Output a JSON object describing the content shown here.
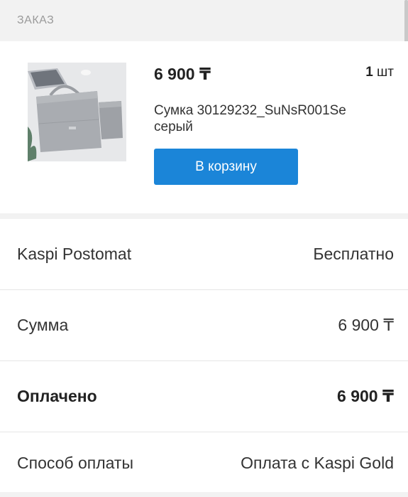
{
  "header": {
    "title": "ЗАКАЗ"
  },
  "order": {
    "price": "6 900 ₸",
    "quantity_number": "1",
    "quantity_unit": "шт",
    "product_name": "Сумка 30129232_SuNsR001Se серый",
    "add_to_cart_label": "В корзину"
  },
  "details": {
    "rows": [
      {
        "label": "Kaspi Postomat",
        "value": "Бесплатно"
      },
      {
        "label": "Сумма",
        "value": "6 900 ₸"
      },
      {
        "label": "Оплачено",
        "value": "6 900 ₸"
      },
      {
        "label": "Способ оплаты",
        "value": "Оплата с Kaspi Gold"
      }
    ]
  },
  "colors": {
    "accent": "#1b85d8",
    "background": "#f2f2f2",
    "card": "#ffffff"
  }
}
